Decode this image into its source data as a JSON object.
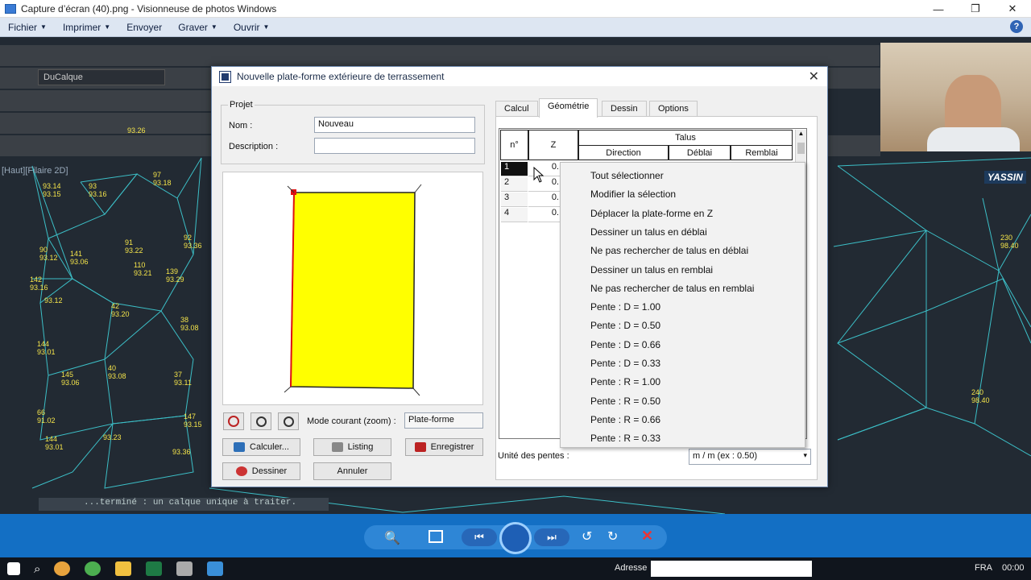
{
  "window": {
    "title": "Capture d’écran (40).png - Visionneuse de photos Windows",
    "min": "—",
    "max": "❐",
    "close": "✕"
  },
  "menubar": {
    "items": [
      "Fichier",
      "Imprimer",
      "Envoyer",
      "Graver",
      "Ouvrir"
    ],
    "help": "?"
  },
  "cad": {
    "layer": "DuCalque",
    "viewport_label": "[Haut][Filaire 2D]",
    "user_label": "YASSIN",
    "command_line": "...terminé : un calque unique à traiter.",
    "points": [
      [
        "93.26"
      ],
      [
        "93.14",
        "93.15"
      ],
      [
        "97",
        "93.18"
      ],
      [
        "93",
        "93.16"
      ],
      [
        "91",
        "93.22"
      ],
      [
        "92",
        "93.36"
      ],
      [
        "90",
        "93.12"
      ],
      [
        "141",
        "93.06"
      ],
      [
        "110",
        "93.21"
      ],
      [
        "139",
        "93.29"
      ],
      [
        "142",
        "93.16"
      ],
      [
        "93.12"
      ],
      [
        "42",
        "93.20"
      ],
      [
        "38",
        "93.08"
      ],
      [
        "144",
        "93.01"
      ],
      [
        "145",
        "93.06"
      ],
      [
        "40",
        "93.08"
      ],
      [
        "37",
        "93.11"
      ],
      [
        "66",
        "91.02"
      ],
      [
        "144",
        "93.01"
      ],
      [
        "147",
        "93.15"
      ],
      [
        "93.23"
      ],
      [
        "93.36"
      ],
      [
        "230",
        "98.40"
      ],
      [
        "240",
        "98.40"
      ]
    ]
  },
  "dialog": {
    "title": "Nouvelle plate-forme extérieure de terrassement",
    "close": "✕",
    "projet": {
      "legend": "Projet",
      "nom_label": "Nom :",
      "nom_value": "Nouveau",
      "description_label": "Description :",
      "description_value": ""
    },
    "mode_label": "Mode courant (zoom) :",
    "mode_value": "Plate-forme",
    "buttons": {
      "calculer": "Calculer...",
      "listing": "Listing",
      "enregistrer": "Enregistrer",
      "dessiner": "Dessiner",
      "annuler": "Annuler"
    },
    "tabs": [
      "Calcul",
      "Géométrie",
      "Dessin",
      "Options"
    ],
    "active_tab": "Géométrie",
    "grid": {
      "h_no": "n°",
      "h_z": "Z",
      "h_talus": "Talus",
      "h_direction": "Direction",
      "h_deblai": "Déblai",
      "h_remblai": "Remblai",
      "rows": [
        {
          "n": "1",
          "z": "0."
        },
        {
          "n": "2",
          "z": "0."
        },
        {
          "n": "3",
          "z": "0."
        },
        {
          "n": "4",
          "z": "0."
        }
      ]
    },
    "unite_label": "Unité des pentes :",
    "unite_value": "m / m       (ex : 0.50)"
  },
  "context_menu": {
    "items": [
      "Tout sélectionner",
      "Modifier la sélection",
      "Déplacer la plate-forme en Z",
      "Dessiner un talus en déblai",
      "Ne pas rechercher de talus en déblai",
      "Dessiner un talus en remblai",
      "Ne pas rechercher de talus en remblai",
      "Pente : D = 1.00",
      "Pente : D = 0.50",
      "Pente : D = 0.66",
      "Pente : D = 0.33",
      "Pente : R = 1.00",
      "Pente : R = 0.50",
      "Pente : R = 0.66",
      "Pente : R = 0.33"
    ]
  },
  "viewer": {
    "address_label": "Adresse"
  },
  "system": {
    "lang": "FRA",
    "time": "00:00"
  },
  "colors": {
    "accent": "#136fc4",
    "platform_fill": "#ffff00",
    "cad_lines": "#3fd0d8"
  }
}
